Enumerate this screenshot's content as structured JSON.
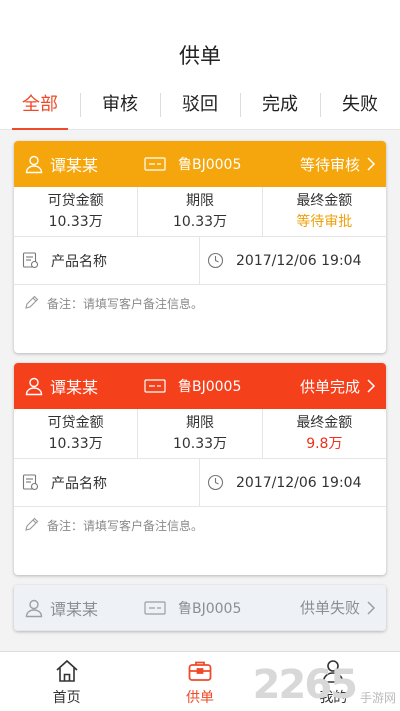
{
  "header": {
    "title": "供单"
  },
  "tabs": [
    {
      "label": "全部",
      "active": true
    },
    {
      "label": "审核",
      "active": false
    },
    {
      "label": "驳回",
      "active": false
    },
    {
      "label": "完成",
      "active": false
    },
    {
      "label": "失败",
      "active": false
    }
  ],
  "cards": [
    {
      "name": "谭某某",
      "id": "鲁BJ0005",
      "status": "等待审核",
      "theme": "orange",
      "loan_label": "可贷金额",
      "loan_value": "10.33万",
      "term_label": "期限",
      "term_value": "10.33万",
      "final_label": "最终金额",
      "final_value": "等待审批",
      "product": "产品名称",
      "time": "2017/12/06 19:04",
      "note": "备注：请填写客户备注信息。"
    },
    {
      "name": "谭某某",
      "id": "鲁BJ0005",
      "status": "供单完成",
      "theme": "red",
      "loan_label": "可贷金额",
      "loan_value": "10.33万",
      "term_label": "期限",
      "term_value": "10.33万",
      "final_label": "最终金额",
      "final_value": "9.8万",
      "product": "产品名称",
      "time": "2017/12/06 19:04",
      "note": "备注：请填写客户备注信息。"
    },
    {
      "name": "谭某某",
      "id": "鲁BJ0005",
      "status": "供单失败",
      "theme": "grey"
    }
  ],
  "nav": {
    "home": "首页",
    "orders": "供单",
    "mine": "我的"
  },
  "watermark": {
    "number": "2265",
    "text": "手游网"
  },
  "colors": {
    "accent": "#f04a2a",
    "orange": "#f5a60c",
    "red": "#f5401c"
  }
}
